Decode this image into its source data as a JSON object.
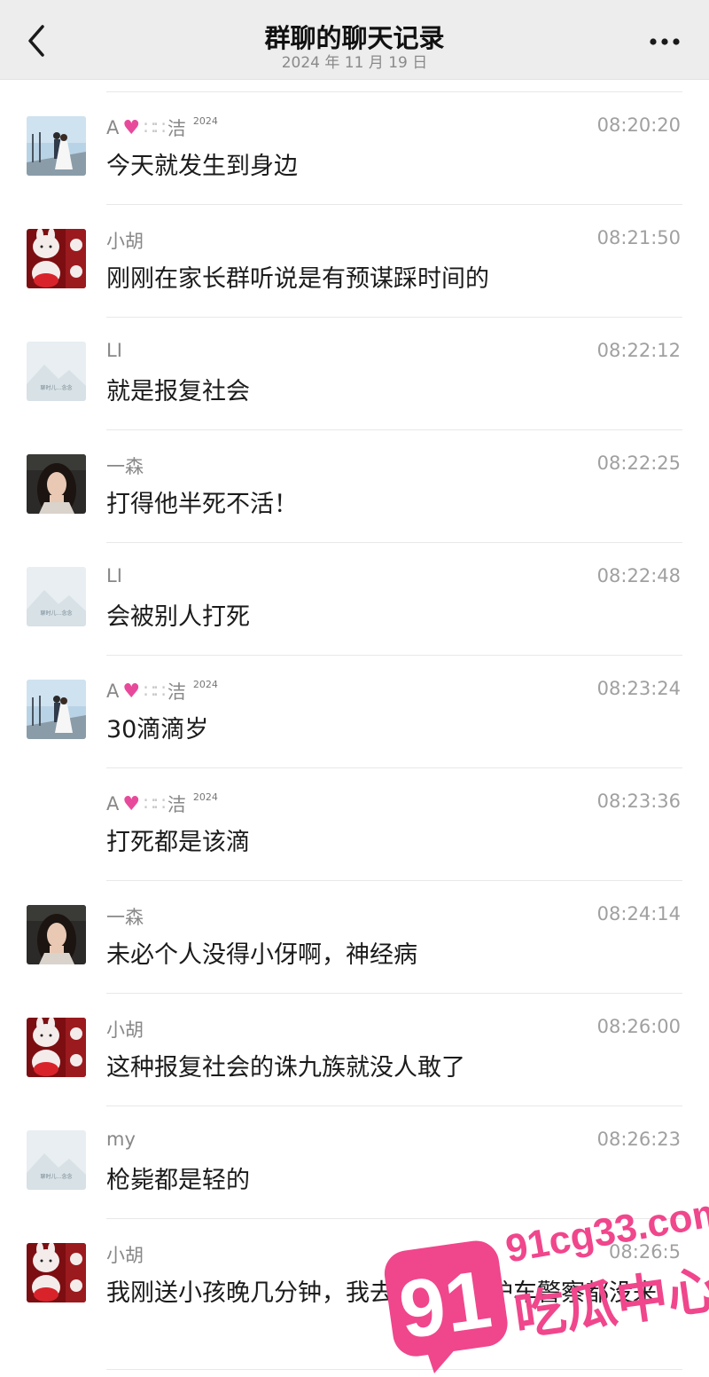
{
  "header": {
    "title": "群聊的聊天记录",
    "subtitle": "2024 年 11 月 19 日"
  },
  "messages": [
    {
      "sender": "A",
      "sender_suffix": "洁",
      "sender_sup": "2024",
      "time": "08:20:20",
      "text": "今天就发生到身边",
      "avatar": "couple-photo"
    },
    {
      "sender": "小胡",
      "time": "08:21:50",
      "text": "刚刚在家长群听说是有预谋踩时间的",
      "avatar": "rabbit-collage"
    },
    {
      "sender": "LI",
      "time": "08:22:12",
      "text": "就是报复社会",
      "avatar": "mountain-placeholder",
      "avatar_caption": "聊时儿…念念"
    },
    {
      "sender": "一森",
      "time": "08:22:25",
      "text": "打得他半死不活！",
      "avatar": "woman-selfie"
    },
    {
      "sender": "LI",
      "time": "08:22:48",
      "text": "会被别人打死",
      "avatar": "mountain-placeholder",
      "avatar_caption": "聊时儿…念念"
    },
    {
      "sender": "A",
      "sender_suffix": "洁",
      "sender_sup": "2024",
      "time": "08:23:24",
      "text": "30滴滴岁",
      "avatar": "couple-photo"
    },
    {
      "sender": "A",
      "sender_suffix": "洁",
      "sender_sup": "2024",
      "time": "08:23:36",
      "text": "打死都是该滴",
      "avatar": ""
    },
    {
      "sender": "一森",
      "time": "08:24:14",
      "text": "未必个人没得小伢啊，神经病",
      "avatar": "woman-selfie"
    },
    {
      "sender": "小胡",
      "time": "08:26:00",
      "text": "这种报复社会的诛九族就没人敢了",
      "avatar": "rabbit-collage"
    },
    {
      "sender": "my",
      "time": "08:26:23",
      "text": "枪毙都是轻的",
      "avatar": "mountain-placeholder",
      "avatar_caption": "聊时儿…念念"
    },
    {
      "sender": "小胡",
      "time": "08:26:5",
      "text": "我刚送小孩晚几分钟，我去的时候救护车警察都没来",
      "avatar": "rabbit-collage"
    }
  ],
  "watermark": {
    "domain": "91cg33.com",
    "badge": "91",
    "label": "吃瓜中心",
    "color": "#f0468c"
  },
  "icons": {
    "back": "chevron-left-icon",
    "more": "more-dots-icon",
    "heart": "pink-heart-icon"
  }
}
